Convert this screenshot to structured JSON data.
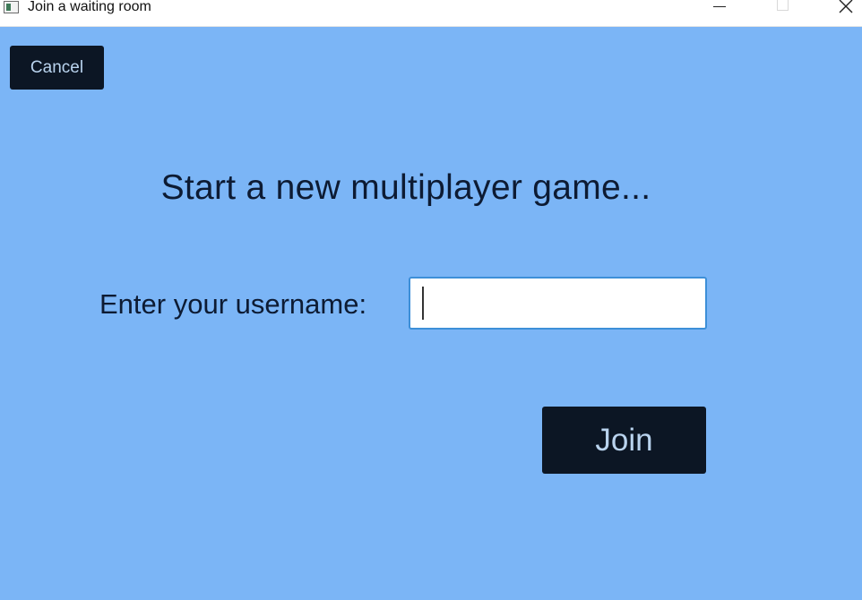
{
  "window": {
    "title": "Join a waiting room",
    "controls": {
      "minimize_icon": "minimize-icon",
      "maximize_icon": "maximize-icon",
      "close_icon": "close-icon"
    }
  },
  "toolbar": {
    "cancel_label": "Cancel"
  },
  "main": {
    "heading": "Start a new multiplayer game...",
    "username_label": "Enter your username:",
    "username_value": "",
    "join_label": "Join"
  },
  "colors": {
    "background": "#7bb5f6",
    "button_bg": "#0c1624",
    "button_text": "#b9d3ee",
    "text": "#0d1b33",
    "input_border": "#3d8fd8"
  }
}
